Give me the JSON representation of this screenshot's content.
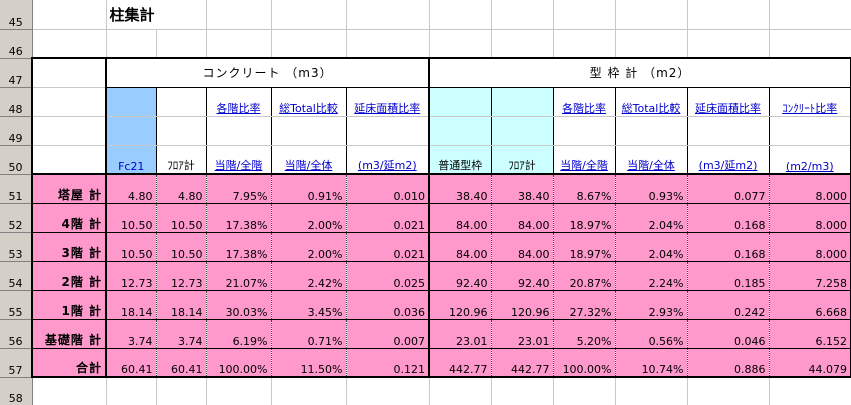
{
  "row_numbers": [
    "45",
    "46",
    "47",
    "48",
    "49",
    "50",
    "51",
    "52",
    "53",
    "54",
    "55",
    "56",
    "57",
    "58"
  ],
  "title": "柱集計",
  "group_concrete": "コンクリート （m3）",
  "group_formwork": "型 枠 計 （m2）",
  "concrete_headers": {
    "fc21": "Fc21",
    "floor_total": "ﾌﾛｱ計",
    "ratio_floor_top": "各階比率",
    "ratio_floor_bottom": "当階/全階",
    "ratio_total_top": "総Total比較",
    "ratio_total_bottom": "当階/全体",
    "area_ratio_top": "延床面積比率",
    "area_ratio_bottom": "(m3/延m2)"
  },
  "formwork_headers": {
    "normal": "普通型枠",
    "floor_total": "ﾌﾛｱ計",
    "ratio_floor_top": "各階比率",
    "ratio_floor_bottom": "当階/全階",
    "ratio_total_top": "総Total比較",
    "ratio_total_bottom": "当階/全体",
    "area_ratio_top": "延床面積比率",
    "area_ratio_bottom": "(m3/延m2)",
    "concrete_ratio_top": "ｺﾝｸﾘｰﾄ比率",
    "concrete_ratio_bottom": "(m2/m3)"
  },
  "colors": {
    "pink": "#ff99cc",
    "blue": "#99ccff",
    "cyan": "#ccffff",
    "header_text": "#0000cc"
  },
  "rows": [
    {
      "label": "塔屋 計",
      "v": [
        "4.80",
        "4.80",
        "7.95%",
        "0.91%",
        "0.010",
        "38.40",
        "38.40",
        "8.67%",
        "0.93%",
        "0.077",
        "8.000"
      ]
    },
    {
      "label": "4階 計",
      "v": [
        "10.50",
        "10.50",
        "17.38%",
        "2.00%",
        "0.021",
        "84.00",
        "84.00",
        "18.97%",
        "2.04%",
        "0.168",
        "8.000"
      ]
    },
    {
      "label": "3階 計",
      "v": [
        "10.50",
        "10.50",
        "17.38%",
        "2.00%",
        "0.021",
        "84.00",
        "84.00",
        "18.97%",
        "2.04%",
        "0.168",
        "8.000"
      ]
    },
    {
      "label": "2階 計",
      "v": [
        "12.73",
        "12.73",
        "21.07%",
        "2.42%",
        "0.025",
        "92.40",
        "92.40",
        "20.87%",
        "2.24%",
        "0.185",
        "7.258"
      ]
    },
    {
      "label": "1階 計",
      "v": [
        "18.14",
        "18.14",
        "30.03%",
        "3.45%",
        "0.036",
        "120.96",
        "120.96",
        "27.32%",
        "2.93%",
        "0.242",
        "6.668"
      ]
    },
    {
      "label": "基礎階 計",
      "v": [
        "3.74",
        "3.74",
        "6.19%",
        "0.71%",
        "0.007",
        "23.01",
        "23.01",
        "5.20%",
        "0.56%",
        "0.046",
        "6.152"
      ]
    },
    {
      "label": "合計",
      "v": [
        "60.41",
        "60.41",
        "100.00%",
        "11.50%",
        "0.121",
        "442.77",
        "442.77",
        "100.00%",
        "10.74%",
        "0.886",
        "44.079"
      ]
    }
  ]
}
